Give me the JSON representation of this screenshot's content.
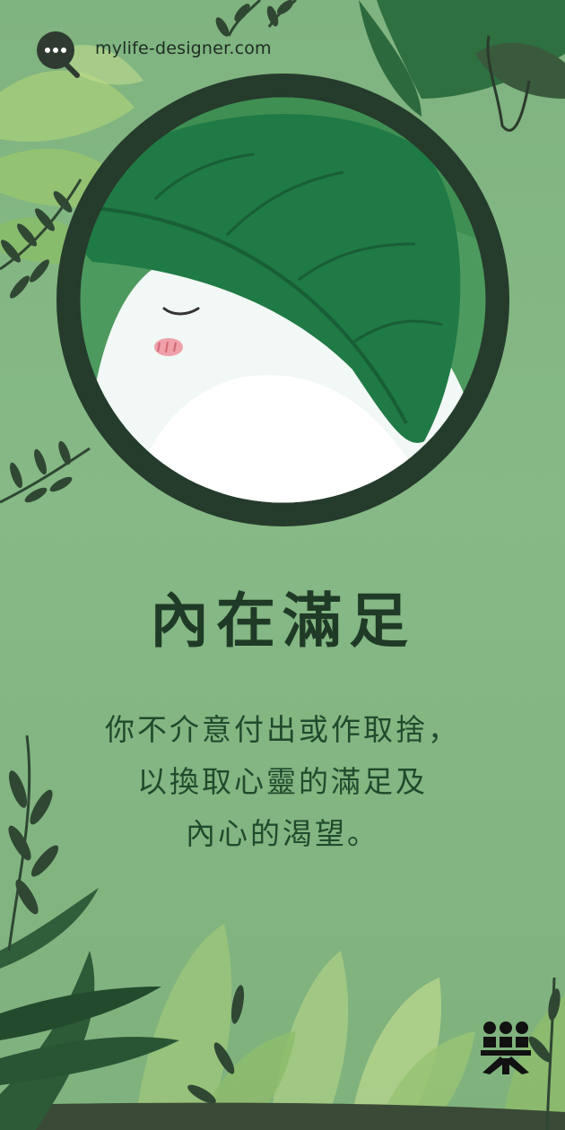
{
  "site": {
    "url": "mylife-designer.com",
    "icon": "chat-search-icon"
  },
  "card": {
    "title": "內在滿足",
    "lines": [
      "你不介意付出或作取捨，",
      "以換取心靈的滿足及",
      "內心的渴望。"
    ]
  },
  "illustration": {
    "subject": "sleeping-character-under-leaf",
    "ring_color": "#253b2c",
    "leaf_color": "#1f7a45"
  },
  "corner_logo": {
    "icon": "brand-people-icon"
  },
  "colors": {
    "background": "#86b985",
    "title": "#1f3a27",
    "text": "#214a2c",
    "dark_foliage": "#2f4733"
  }
}
